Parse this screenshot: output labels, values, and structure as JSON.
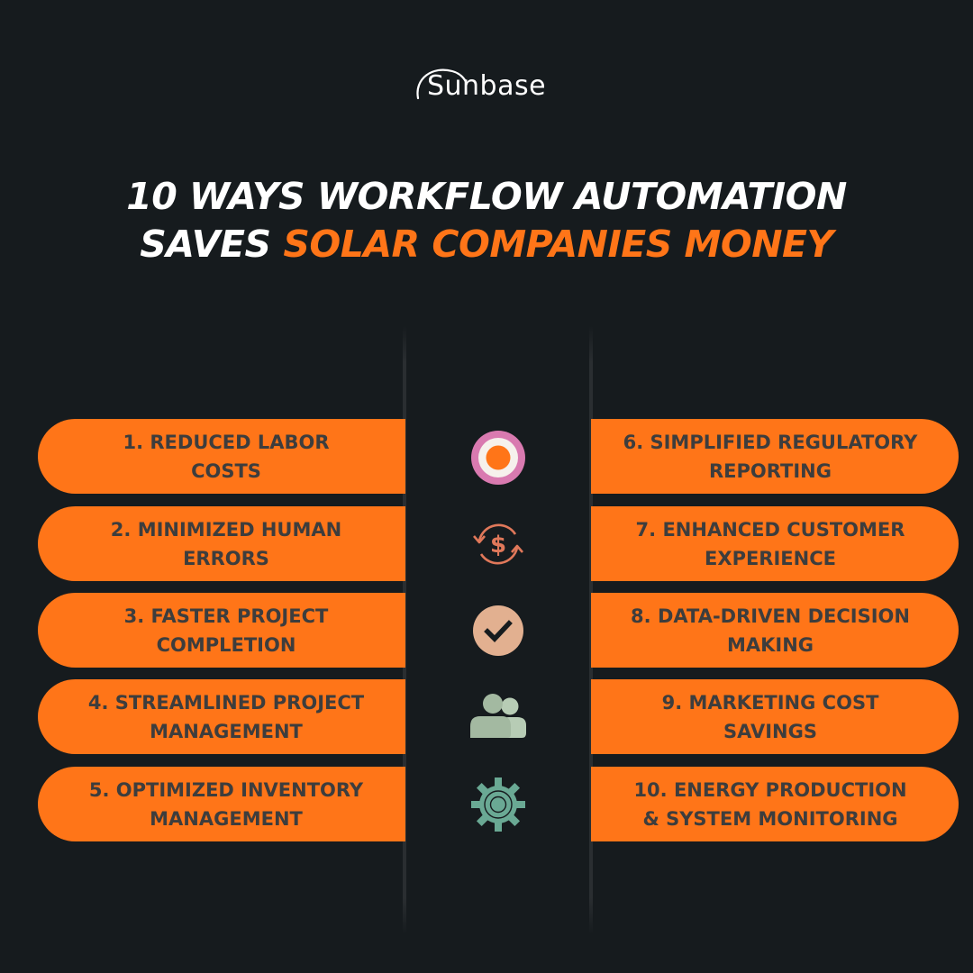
{
  "brand": {
    "logo_text": "Sunbase",
    "icon": "sun-arc-logo-icon"
  },
  "title": {
    "line1": "10 WAYS WORKFLOW AUTOMATION",
    "line2_white": "SAVES ",
    "line2_accent": "SOLAR COMPANIES MONEY"
  },
  "colors": {
    "background": "#161b1e",
    "accent": "#ff7518",
    "pill_text": "#3d3d3d",
    "title_text": "#ffffff"
  },
  "left_items": [
    {
      "label": "1. REDUCED LABOR\nCOSTS"
    },
    {
      "label": "2. MINIMIZED HUMAN\nERRORS"
    },
    {
      "label": "3. FASTER PROJECT\nCOMPLETION"
    },
    {
      "label": "4. STREAMLINED PROJECT\nMANAGEMENT"
    },
    {
      "label": "5. OPTIMIZED INVENTORY\nMANAGEMENT"
    }
  ],
  "right_items": [
    {
      "label": "6. SIMPLIFIED REGULATORY\nREPORTING"
    },
    {
      "label": "7. ENHANCED CUSTOMER\nEXPERIENCE"
    },
    {
      "label": "8. DATA-DRIVEN DECISION\nMAKING"
    },
    {
      "label": "9. MARKETING COST\nSAVINGS"
    },
    {
      "label": "10. ENERGY PRODUCTION\n& SYSTEM MONITORING"
    }
  ],
  "icons": [
    {
      "name": "target-icon",
      "color": "#d97ab0"
    },
    {
      "name": "dollar-refresh-icon",
      "color": "#e0785a"
    },
    {
      "name": "checkmark-circle-icon",
      "color": "#e2b090"
    },
    {
      "name": "users-icon",
      "color": "#a9c0a8"
    },
    {
      "name": "gear-icon",
      "color": "#6aa994"
    }
  ]
}
